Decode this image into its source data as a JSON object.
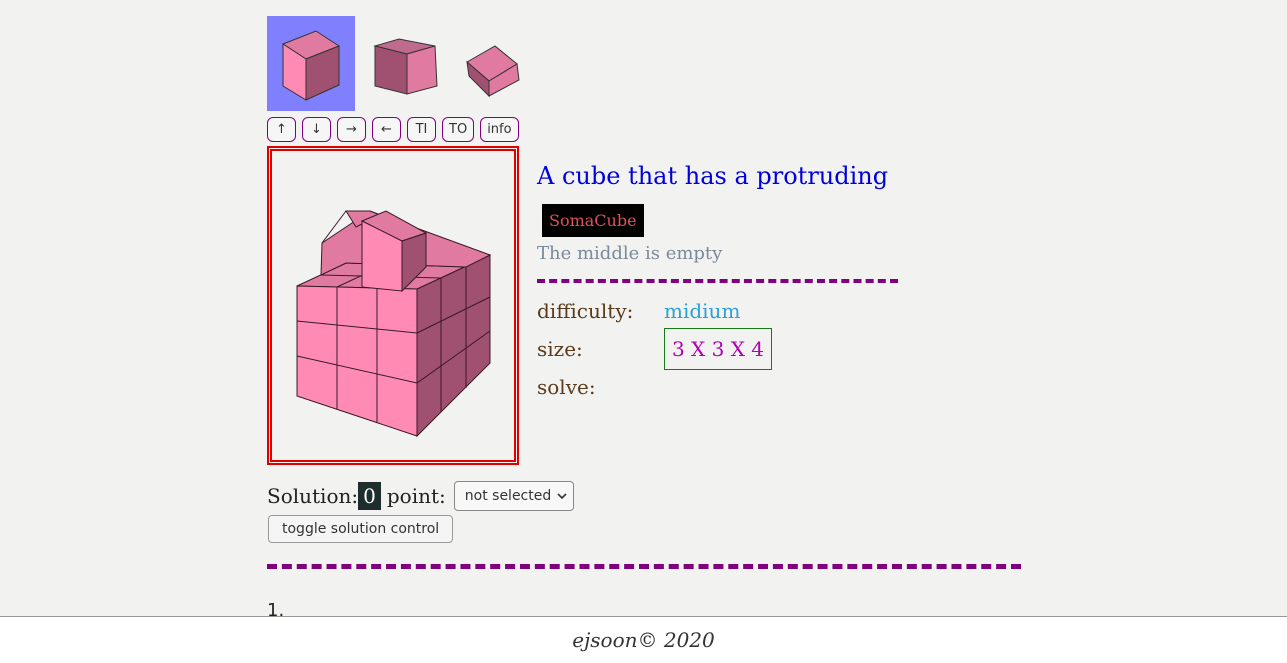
{
  "thumbnails": [
    {
      "name": "thumb-view-1",
      "active": true
    },
    {
      "name": "thumb-view-2",
      "active": false
    },
    {
      "name": "thumb-view-3",
      "active": false
    }
  ],
  "controls": {
    "up": "↑",
    "down": "↓",
    "right": "→",
    "left": "←",
    "ti": "TI",
    "to": "TO",
    "info": "info"
  },
  "puzzle": {
    "title": "A cube that has a protruding",
    "tag": "SomaCube",
    "subtitle": "The middle is empty",
    "difficulty_label": "difficulty:",
    "difficulty_value": "midium",
    "size_label": "size:",
    "size_value": "3 X 3 X 4",
    "solve_label": "solve:"
  },
  "solution": {
    "label": "Solution:",
    "count": "0",
    "point_label": "point:",
    "point_selected": "not selected",
    "toggle_label": "toggle solution control"
  },
  "list": {
    "first_index": "1."
  },
  "footer": {
    "text": "ejsoon© 2020"
  },
  "colors": {
    "cube_top": "#e07aa0",
    "cube_front": "#ff8ab4",
    "cube_side": "#a05070",
    "accent": "#800080"
  }
}
